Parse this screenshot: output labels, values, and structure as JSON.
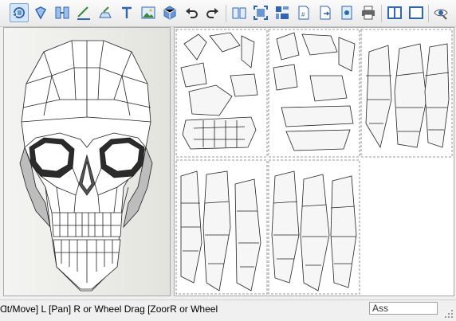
{
  "toolbar": {
    "tools": [
      {
        "name": "select-rotate-tool",
        "icon": "rotate-select-icon",
        "active": true
      },
      {
        "name": "unfold-tool",
        "icon": "unfold-icon"
      },
      {
        "name": "join-tool",
        "icon": "join-edges-icon"
      },
      {
        "name": "line-tool",
        "icon": "line-style-icon"
      },
      {
        "name": "flap-tool",
        "icon": "flap-icon"
      },
      {
        "name": "text-tool",
        "icon": "text-icon"
      },
      {
        "name": "image-tool",
        "icon": "image-icon"
      },
      {
        "name": "model-tool",
        "icon": "cube-icon"
      },
      {
        "name": "undo",
        "icon": "undo-icon"
      },
      {
        "name": "redo",
        "icon": "redo-icon"
      },
      {
        "name": "book-view",
        "icon": "book-icon"
      },
      {
        "name": "fit-view",
        "icon": "fit-icon"
      },
      {
        "name": "arrange",
        "icon": "arrange-parts-icon"
      },
      {
        "name": "page-number",
        "icon": "page-number-icon"
      },
      {
        "name": "export",
        "icon": "export-page-icon"
      },
      {
        "name": "page-setup",
        "icon": "page-setup-icon"
      },
      {
        "name": "print",
        "icon": "printer-icon"
      },
      {
        "name": "split-view",
        "icon": "split-view-icon"
      },
      {
        "name": "single-view",
        "icon": "window-icon"
      },
      {
        "name": "visibility",
        "icon": "eye-icon"
      }
    ]
  },
  "status": {
    "text": "Ɑt/Move] L [Pan] R or Wheel Drag [ZoorR or Wheel",
    "field": "Ass"
  },
  "colors": {
    "accent": "#2b5fa8",
    "toolbar_icon": "#2e66b5"
  }
}
